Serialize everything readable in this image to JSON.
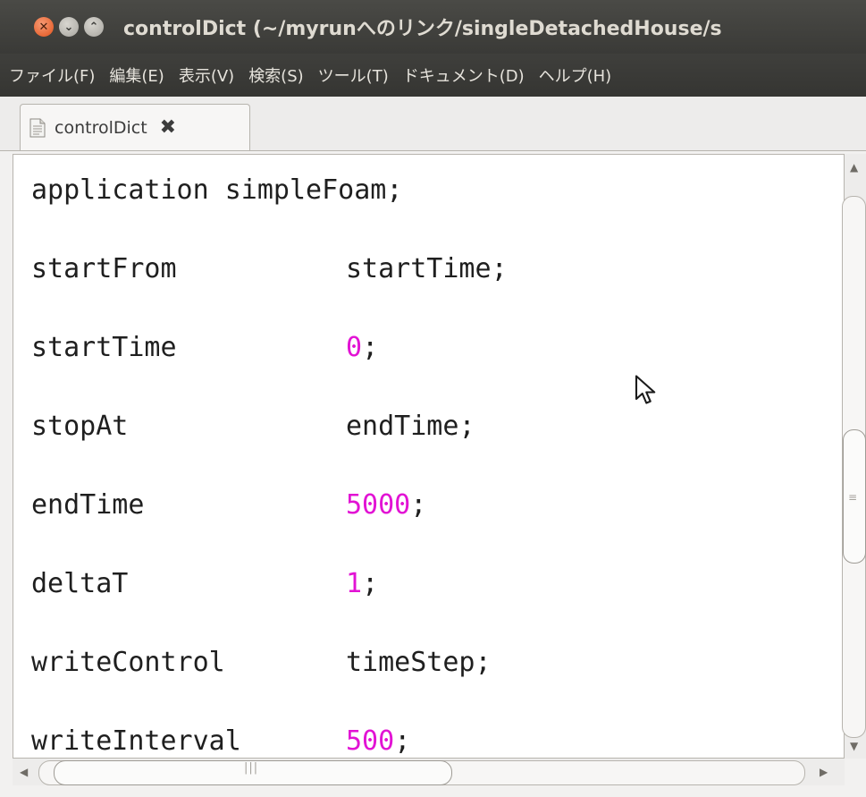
{
  "window": {
    "title": "controlDict (~/myrunへのリンク/singleDetachedHouse/s",
    "buttons": {
      "close": "✕",
      "minimize": "⌄",
      "maximize": "⌃"
    }
  },
  "menu": [
    "ファイル(F)",
    "編集(E)",
    "表示(V)",
    "検索(S)",
    "ツール(T)",
    "ドキュメント(D)",
    "ヘルプ(H)"
  ],
  "tab": {
    "label": "controlDict",
    "close": "✖"
  },
  "editor": {
    "first_line": "application simpleFoam;",
    "lines": [
      {
        "key": "startFrom",
        "value": "startTime",
        "numeric": false
      },
      {
        "key": "startTime",
        "value": "0",
        "numeric": true
      },
      {
        "key": "stopAt",
        "value": "endTime",
        "numeric": false
      },
      {
        "key": "endTime",
        "value": "5000",
        "numeric": true
      },
      {
        "key": "deltaT",
        "value": "1",
        "numeric": true
      },
      {
        "key": "writeControl",
        "value": "timeStep",
        "numeric": false
      },
      {
        "key": "writeInterval",
        "value": "500",
        "numeric": true
      }
    ],
    "semicolon": ";",
    "number_color": "#e213d4"
  },
  "scrollbars": {
    "grip_v": "≡",
    "grip_h": "|||"
  }
}
